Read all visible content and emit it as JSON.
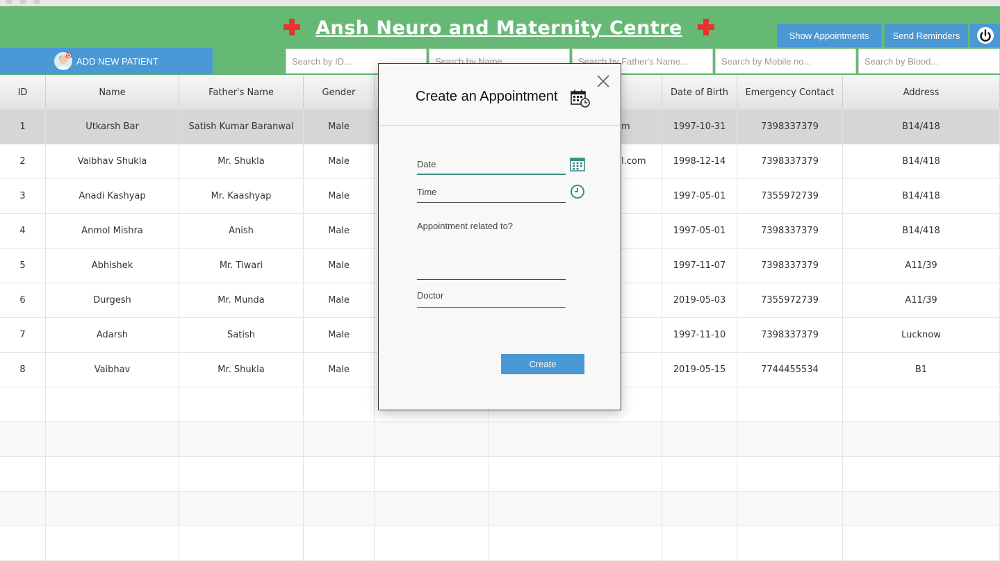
{
  "app": {
    "title": "Ansh Neuro and Maternity Centre"
  },
  "header": {
    "show_appointments": "Show Appointments",
    "send_reminders": "Send Reminders",
    "add_new_patient": "ADD NEW PATIENT"
  },
  "search": {
    "id": "Search by ID...",
    "name": "Search by Name...",
    "father": "Search by Father's Name...",
    "mobile": "Search by Mobile no...",
    "blood": "Search by Blood..."
  },
  "table": {
    "columns": [
      "ID",
      "Name",
      "Father's Name",
      "Gender",
      "",
      "",
      "Date of Birth",
      "Emergency Contact",
      "Address"
    ],
    "rows": [
      {
        "id": "1",
        "name": "Utkarsh Bar",
        "father": "Satish Kumar Baranwal",
        "gender": "Male",
        "email_tail": "m",
        "dob": "1997-10-31",
        "contact": "7398337379",
        "address": "B14/418"
      },
      {
        "id": "2",
        "name": "Vaibhav Shukla",
        "father": "Mr. Shukla",
        "gender": "Male",
        "email_tail": "l.com",
        "dob": "1998-12-14",
        "contact": "7398337379",
        "address": "B14/418"
      },
      {
        "id": "3",
        "name": "Anadi Kashyap",
        "father": "Mr. Kaashyap",
        "gender": "Male",
        "email_tail": "",
        "dob": "1997-05-01",
        "contact": "7355972739",
        "address": "B14/418"
      },
      {
        "id": "4",
        "name": "Anmol Mishra",
        "father": "Anish",
        "gender": "Male",
        "email_tail": "",
        "dob": "1997-05-01",
        "contact": "7398337379",
        "address": "B14/418"
      },
      {
        "id": "5",
        "name": "Abhishek",
        "father": "Mr. Tiwari",
        "gender": "Male",
        "email_tail": "",
        "dob": "1997-11-07",
        "contact": "7398337379",
        "address": "A11/39"
      },
      {
        "id": "6",
        "name": "Durgesh",
        "father": "Mr. Munda",
        "gender": "Male",
        "email_tail": "",
        "dob": "2019-05-03",
        "contact": "7355972739",
        "address": "A11/39"
      },
      {
        "id": "7",
        "name": "Adarsh",
        "father": "Satish",
        "gender": "Male",
        "email_tail": "",
        "dob": "1997-11-10",
        "contact": "7398337379",
        "address": "Lucknow"
      },
      {
        "id": "8",
        "name": "Vaibhav",
        "father": "Mr. Shukla",
        "gender": "Male",
        "email_tail": "",
        "dob": "2019-05-15",
        "contact": "7744455534",
        "address": "B1"
      }
    ]
  },
  "dialog": {
    "title": "Create an Appointment",
    "date_label": "Date",
    "time_label": "Time",
    "related_label": "Appointment related to?",
    "doctor_label": "Doctor",
    "create_label": "Create"
  },
  "colors": {
    "header_green": "#66b975",
    "button_blue": "#4a98d4",
    "cross_red": "#e8322e",
    "field_accent": "#3a8f86"
  },
  "icons": {
    "header_cross": "red-cross-icon",
    "power": "power-icon",
    "avatar": "doctor-avatar-icon",
    "calendar": "calendar-icon",
    "clock": "clock-icon",
    "close": "close-icon",
    "calendar_clock": "calendar-clock-icon"
  }
}
